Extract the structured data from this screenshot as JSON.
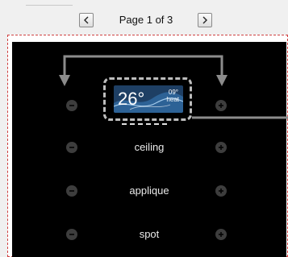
{
  "toolbar": {
    "prev_label": "<",
    "next_label": ">",
    "page_label": "Page 1 of 3"
  },
  "thermostat": {
    "temperature": "26°",
    "setpoint": "09°",
    "mode": "heat"
  },
  "rows": [
    {
      "label": "ceiling"
    },
    {
      "label": "applique"
    },
    {
      "label": "spot"
    }
  ],
  "icons": {
    "minus": "minus-icon",
    "plus": "plus-icon",
    "prev": "chevron-left-icon",
    "next": "chevron-right-icon"
  },
  "colors": {
    "panel_background": "#000000",
    "connector_line": "#8c8c8c",
    "thermostat_screen": "#1e3f64",
    "canvas_border": "#d04040",
    "dot_button": "#3d3d3d"
  }
}
